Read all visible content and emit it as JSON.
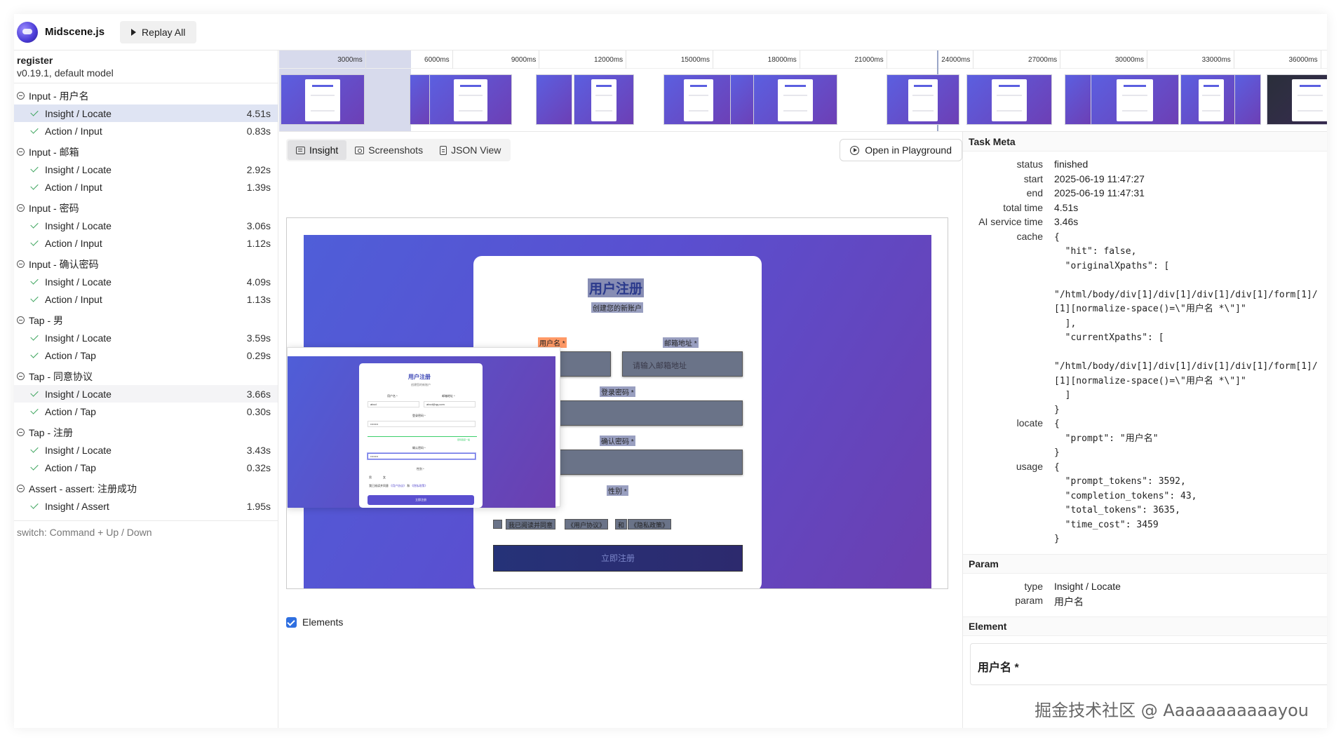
{
  "header": {
    "brand": "Midscene.js",
    "replay_label": "Replay All"
  },
  "sidebar": {
    "task_title": "register",
    "task_sub": "v0.19.1, default model",
    "groups": [
      {
        "title": "Input - 用户名",
        "steps": [
          {
            "label": "Insight / Locate",
            "dur": "4.51s"
          },
          {
            "label": "Action / Input",
            "dur": "0.83s"
          }
        ]
      },
      {
        "title": "Input - 邮箱",
        "steps": [
          {
            "label": "Insight / Locate",
            "dur": "2.92s"
          },
          {
            "label": "Action / Input",
            "dur": "1.39s"
          }
        ]
      },
      {
        "title": "Input - 密码",
        "steps": [
          {
            "label": "Insight / Locate",
            "dur": "3.06s"
          },
          {
            "label": "Action / Input",
            "dur": "1.12s"
          }
        ]
      },
      {
        "title": "Input - 确认密码",
        "steps": [
          {
            "label": "Insight / Locate",
            "dur": "4.09s"
          },
          {
            "label": "Action / Input",
            "dur": "1.13s"
          }
        ]
      },
      {
        "title": "Tap - 男",
        "steps": [
          {
            "label": "Insight / Locate",
            "dur": "3.59s"
          },
          {
            "label": "Action / Tap",
            "dur": "0.29s"
          }
        ]
      },
      {
        "title": "Tap - 同意协议",
        "steps": [
          {
            "label": "Insight / Locate",
            "dur": "3.66s"
          },
          {
            "label": "Action / Tap",
            "dur": "0.30s"
          }
        ]
      },
      {
        "title": "Tap - 注册",
        "steps": [
          {
            "label": "Insight / Locate",
            "dur": "3.43s"
          },
          {
            "label": "Action / Tap",
            "dur": "0.32s"
          }
        ]
      },
      {
        "title": "Assert - assert: 注册成功",
        "steps": [
          {
            "label": "Insight / Assert",
            "dur": "1.95s"
          }
        ]
      }
    ],
    "hint": "switch: Command + Up / Down"
  },
  "timeline": {
    "ticks": [
      "3000ms",
      "6000ms",
      "9000ms",
      "12000ms",
      "15000ms",
      "18000ms",
      "21000ms",
      "24000ms",
      "27000ms",
      "30000ms",
      "33000ms",
      "36000ms"
    ]
  },
  "tabs": {
    "insight": "Insight",
    "screenshots": "Screenshots",
    "json_view": "JSON View",
    "playground": "Open in Playground"
  },
  "screenshot": {
    "title": "用户注册",
    "subtitle": "创建您的新账户",
    "username_label": "用户名 *",
    "email_label": "邮箱地址 *",
    "email_placeholder": "请输入邮箱地址",
    "password_label": "登录密码 *",
    "confirm_label": "确认密码 *",
    "gender_label": "性别 *",
    "agree_text": "我已阅读并同意",
    "terms": "《用户协议》",
    "and": "和",
    "privacy": "《隐私政策》",
    "submit": "立即注册"
  },
  "popup": {
    "title": "用户注册",
    "subtitle": "创建您的新账户",
    "user_label": "用户名 *",
    "email_label": "邮箱地址 *",
    "user_value": "abcd",
    "email_value": "abcd@qq.com",
    "pw_label": "登录密码 *",
    "pw_value": "••••••••",
    "pw_strength": "密码强度一般",
    "confirm_label": "确认密码 *",
    "confirm_value": "••••••••",
    "gender_label": "性别 *",
    "male": "男",
    "female": "女",
    "agree": "我已阅读并同意",
    "terms": "《用户协议》",
    "and": "和",
    "privacy": "《隐私政策》",
    "submit": "立即注册"
  },
  "elements_label": "Elements",
  "task_meta": {
    "heading": "Task Meta",
    "status_key": "status",
    "status": "finished",
    "start_key": "start",
    "start": "2025-06-19 11:47:27",
    "end_key": "end",
    "end": "2025-06-19 11:47:31",
    "total_key": "total time",
    "total": "4.51s",
    "ai_key": "AI service time",
    "ai": "3.46s",
    "cache_key": "cache",
    "cache": "{\n  \"hit\": false,\n  \"originalXpaths\": [\n\n\"/html/body/div[1]/div[1]/div[1]/div[1]/form[1]/\n[1][normalize-space()=\\\"用户名 *\\\"]\"\n  ],\n  \"currentXpaths\": [\n\n\"/html/body/div[1]/div[1]/div[1]/div[1]/form[1]/\n[1][normalize-space()=\\\"用户名 *\\\"]\"\n  ]\n}",
    "locate_key": "locate",
    "locate": "{\n  \"prompt\": \"用户名\"\n}",
    "usage_key": "usage",
    "usage": "{\n  \"prompt_tokens\": 3592,\n  \"completion_tokens\": 43,\n  \"total_tokens\": 3635,\n  \"time_cost\": 3459\n}"
  },
  "param": {
    "heading": "Param",
    "type_key": "type",
    "type": "Insight / Locate",
    "param_key": "param",
    "param": "用户名"
  },
  "element": {
    "heading": "Element",
    "label": "用户名 *"
  },
  "watermark": "掘金技术社区 @ Aaaaaaaaaaayou"
}
